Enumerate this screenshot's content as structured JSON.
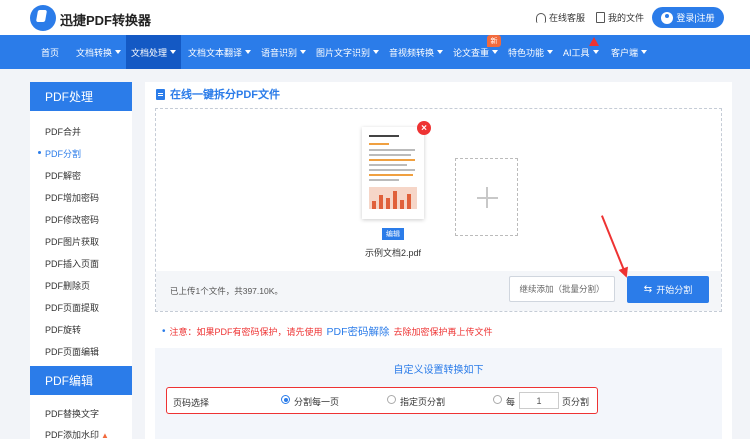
{
  "header": {
    "logo_text": "迅捷PDF转换器",
    "online_service": "在线客服",
    "my_files": "我的文件",
    "login": "登录|注册"
  },
  "nav": {
    "items": [
      "首页",
      "文档转换",
      "文档处理",
      "文档文本翻译",
      "语音识别",
      "图片文字识别",
      "音视频转换",
      "论文查重",
      "特色功能",
      "AI工具",
      "客户端"
    ],
    "new_badge": "新"
  },
  "sidebar": {
    "group1_title": "PDF处理",
    "group1_items": [
      "PDF合并",
      "PDF分割",
      "PDF解密",
      "PDF增加密码",
      "PDF修改密码",
      "PDF图片获取",
      "PDF插入页面",
      "PDF删除页",
      "PDF页面提取",
      "PDF旋转",
      "PDF页面编辑"
    ],
    "group2_title": "PDF编辑",
    "group2_items": [
      "PDF替换文字",
      "PDF添加水印"
    ]
  },
  "main": {
    "section_title": "在线一键拆分PDF文件",
    "file": {
      "name": "示例文档2.pdf",
      "edit_label": "编辑"
    },
    "upload_info": "已上传1个文件，共397.10K。",
    "continue_button": "继续添加（批量分割）",
    "start_button": "开始分割",
    "notice_prefix": "注意：如果PDF有密码保护，请先使用",
    "notice_link": "PDF密码解除",
    "notice_suffix": "去除加密保护再上传文件",
    "settings_title": "自定义设置转换如下",
    "page_select_label": "页码选择",
    "options": [
      "分割每一页",
      "指定页分割",
      "每",
      "页分割"
    ],
    "selected_option": "分割每一页",
    "pages_per_split": "1"
  },
  "colors": {
    "primary": "#2b7ce9",
    "nav_active": "#1459c4",
    "alert": "#e33333",
    "badge": "#f26a3d"
  }
}
